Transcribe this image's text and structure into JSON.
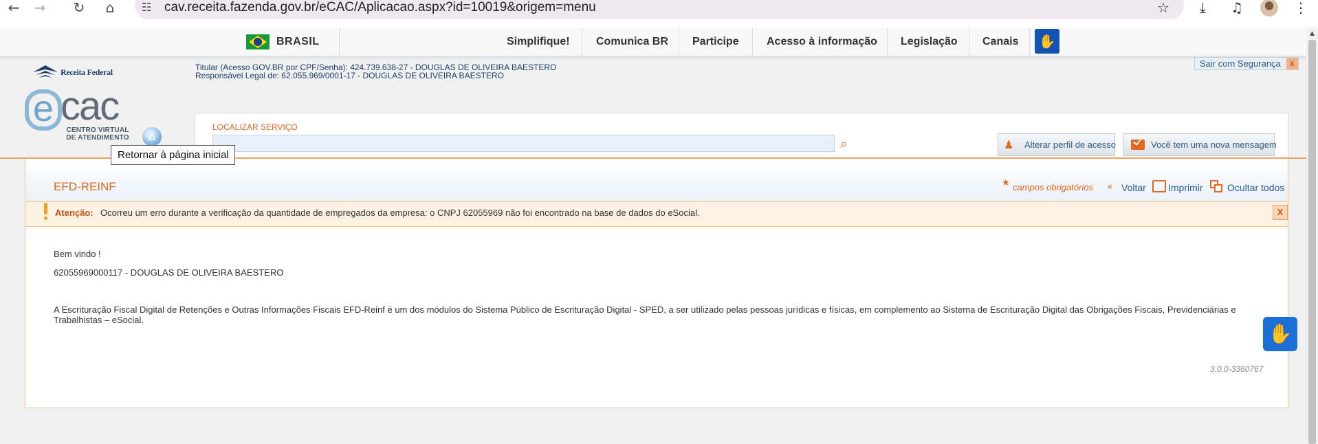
{
  "browser": {
    "back_icon": "←",
    "forward_icon": "→",
    "reload_icon": "↻",
    "home_icon": "⌂",
    "site_info_icon": "☷",
    "url": "cav.receita.fazenda.gov.br/eCAC/Aplicacao.aspx?id=10019&origem=menu",
    "bookmark_icon": "☆",
    "download_icon": "⤓",
    "media_icon": "♫",
    "menu_icon": "⋮"
  },
  "gov_bar": {
    "brand": "BRASIL",
    "links": [
      "Simplifique!",
      "Comunica BR",
      "Participe",
      "Acesso à informação",
      "Legislação",
      "Canais"
    ],
    "accessibility_icon": "✋"
  },
  "header": {
    "rf_logo_text": "Receita Federal",
    "ecac_e": "e",
    "ecac_cac": "cac",
    "ecac_sub_1": "CENTRO VIRTUAL",
    "ecac_sub_2": "DE ATENDIMENTO",
    "home_icon": "⌂",
    "tooltip": "Retornar à página inicial",
    "titular_line1": "Titular (Acesso GOV.BR por CPF/Senha): 424.739.638-27 - DOUGLAS DE OLIVEIRA BAESTERO",
    "titular_line2": "Responsável Legal de: 62.055.969/0001-17 - DOUGLAS DE OLIVEIRA BAESTERO",
    "logout_label": "Sair com Segurança",
    "logout_close": "x"
  },
  "search": {
    "label": "LOCALIZAR SERVIÇO",
    "value": "",
    "search_icon": "⌕",
    "profile_icon": "♟",
    "profile_button": "Alterar perfil de acesso",
    "message_button": "Você tem uma nova mensagem"
  },
  "page": {
    "title": "EFD-REINF",
    "required_star": "*",
    "required_text": "campos obrigatórios",
    "back_icon": "«",
    "back_label": "Voltar",
    "print_label": "Imprimir",
    "hide_label": "Ocultar todos"
  },
  "alert": {
    "label": "Atenção:",
    "text": "Ocorreu um erro durante a verificação da quantidade de empregados da empresa: o CNPJ 62055969 não foi encontrado na base de dados do eSocial.",
    "close": "X"
  },
  "body": {
    "welcome": "Bem vindo !",
    "account": "62055969000117 - DOUGLAS DE OLIVEIRA BAESTERO",
    "description": "A Escrituração Fiscal Digital de Retenções e Outras Informações Fiscais EFD-Reinf é um dos módulos do Sistema Público de Escrituração Digital - SPED, a ser utilizado pelas pessoas jurídicas e físicas, em complemento ao Sistema de Escrituração Digital das Obrigações Fiscais, Previdenciárias e Trabalhistas – eSocial.",
    "version": "3.0.0-3360767"
  },
  "accessibility_float_icon": "✋",
  "scroll_up_icon": "▲"
}
